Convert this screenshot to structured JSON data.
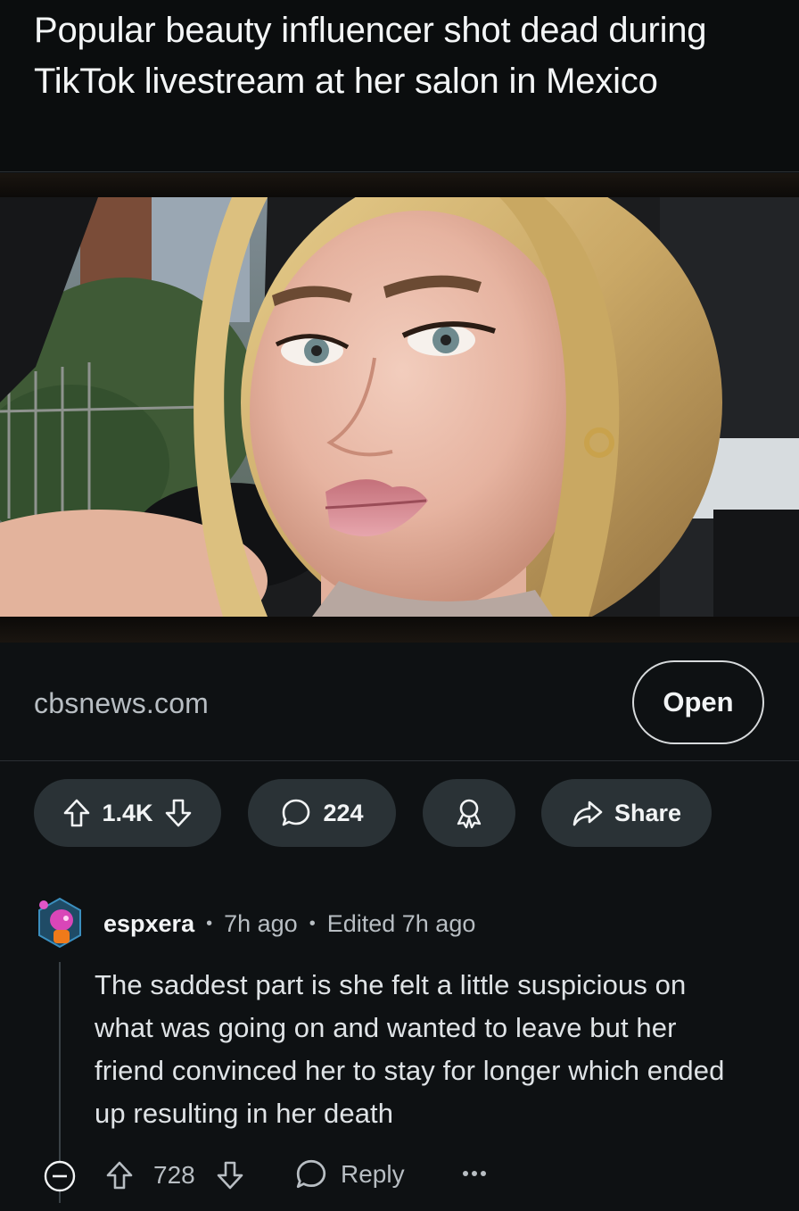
{
  "post": {
    "title": "Popular beauty influencer shot dead during TikTok livestream at her salon in Mexico",
    "link_domain": "cbsnews.com",
    "open_label": "Open",
    "vote_count": "1.4K",
    "comment_count": "224",
    "share_label": "Share"
  },
  "comment": {
    "author": "espxera",
    "time": "7h ago",
    "edited": "Edited 7h ago",
    "body": "The saddest part is she felt a little suspicious on what was going on and wanted to leave but her friend convinced her to stay for longer which ended up resulting in her death",
    "vote_count": "728",
    "reply_label": "Reply"
  },
  "icons": {
    "upvote": "arrow-up-outline-icon",
    "downvote": "arrow-down-outline-icon",
    "comments": "speech-bubble-icon",
    "award": "award-ribbon-icon",
    "share": "share-arrow-icon",
    "collapse": "collapse-minus-circle-icon",
    "more": "more-horizontal-icon"
  },
  "colors": {
    "background": "#0e1113",
    "pill": "#2a3236",
    "text": "#f2f4f5",
    "muted": "#b8bec3"
  }
}
